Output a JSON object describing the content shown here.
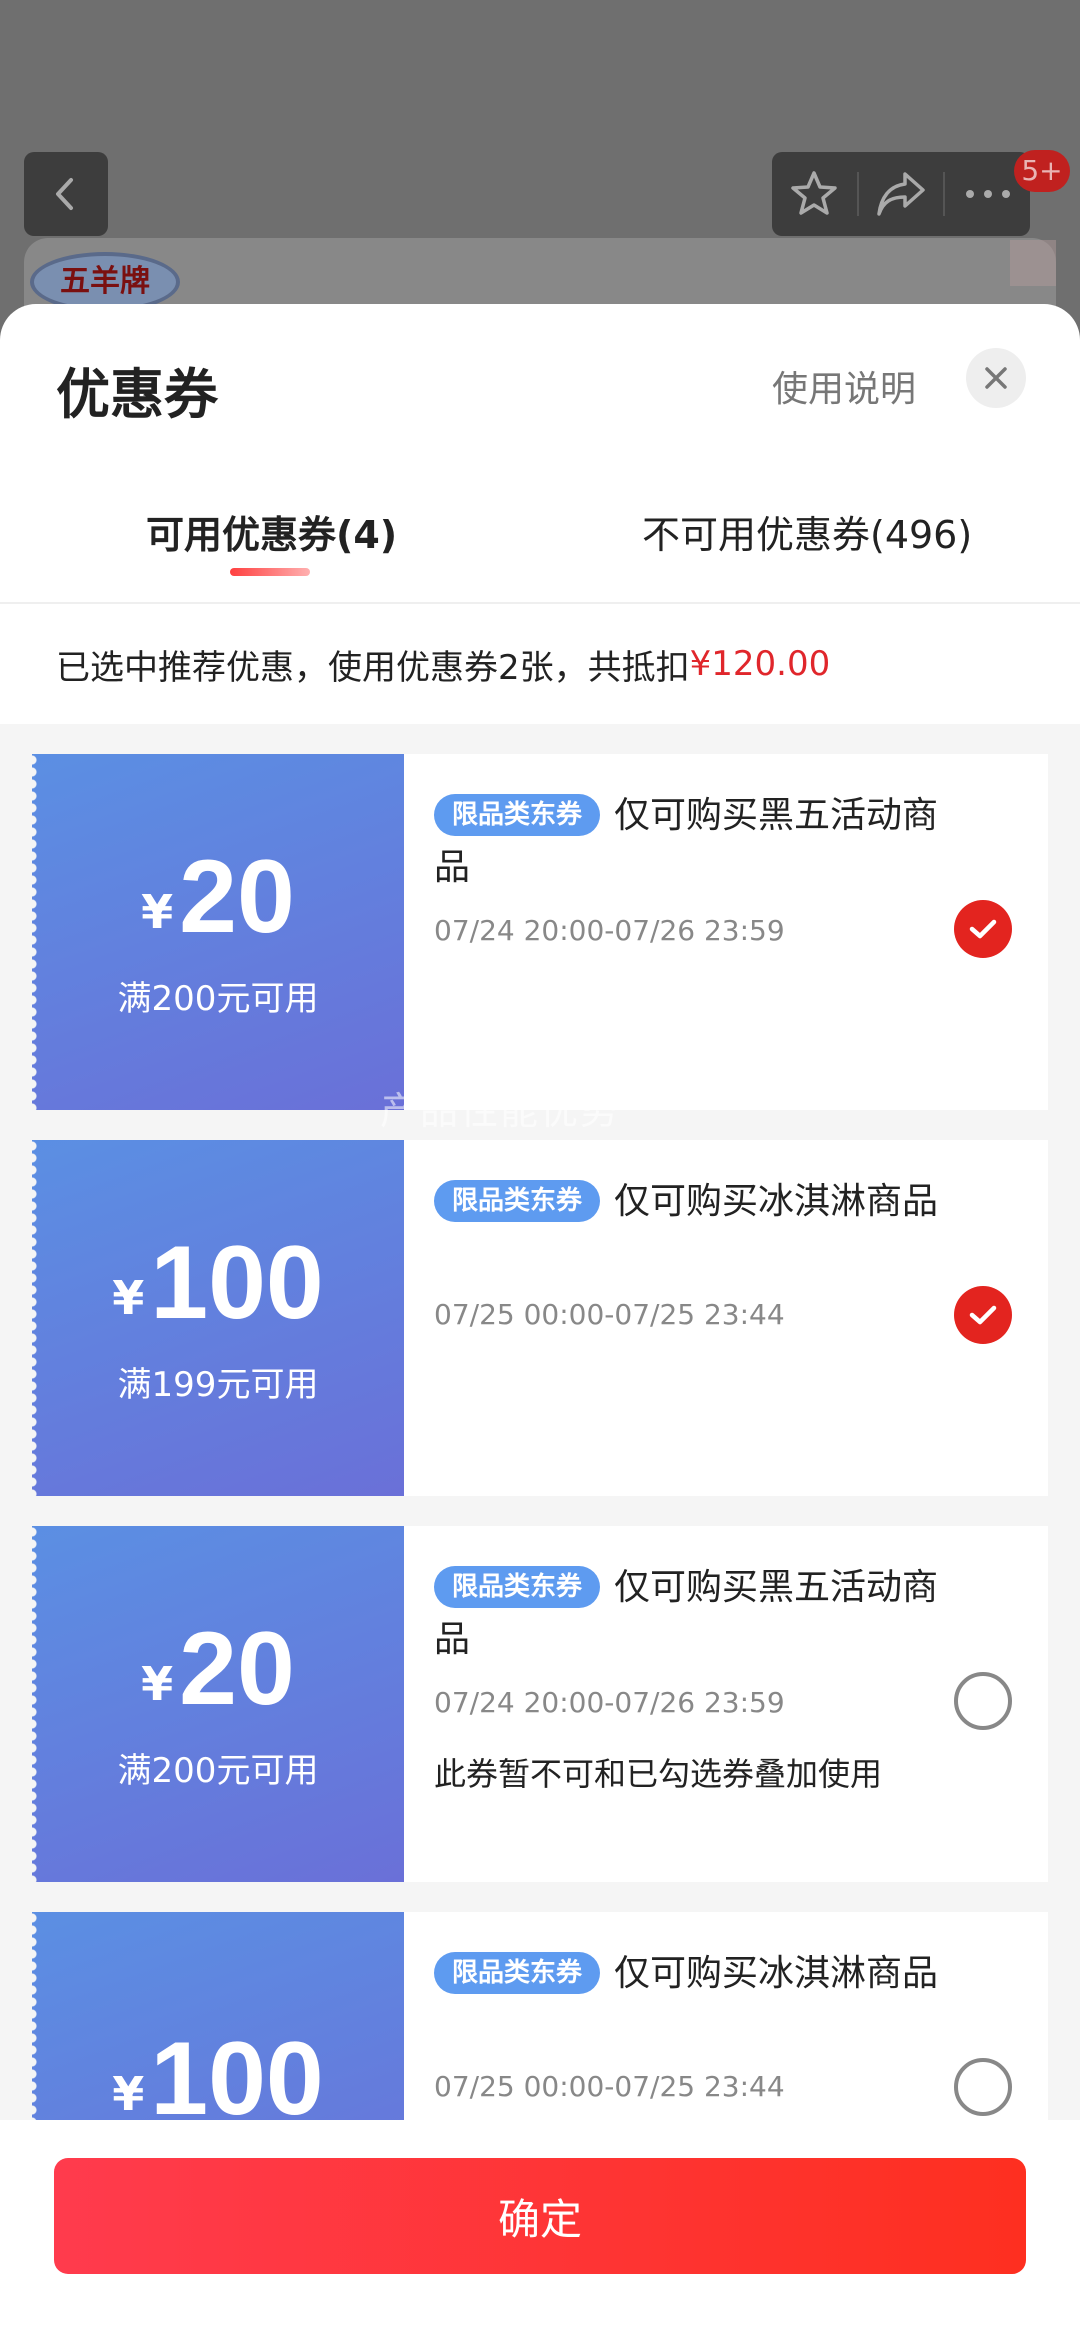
{
  "background": {
    "brand_logo_text": "五羊牌",
    "cart_badge": "5+",
    "icons": {
      "back": "chevron-left-icon",
      "favorite": "star-icon",
      "share": "share-icon",
      "more": "more-dots-icon"
    }
  },
  "sheet": {
    "title": "优惠券",
    "help_link": "使用说明",
    "close_icon": "close-icon"
  },
  "tabs": [
    {
      "label": "可用优惠券(4)",
      "active": true
    },
    {
      "label": "不可用优惠券(496)",
      "active": false
    }
  ],
  "summary": {
    "text": "已选中推荐优惠，使用优惠券2张，共抵扣",
    "amount": "¥120.00"
  },
  "coupons": [
    {
      "currency": "¥",
      "value": "20",
      "threshold": "满200元可用",
      "tag": "限品类东券",
      "title": "仅可购买黑五活动商品",
      "validity": "07/24 20:00-07/26 23:59",
      "note": "",
      "selected": true
    },
    {
      "currency": "¥",
      "value": "100",
      "threshold": "满199元可用",
      "tag": "限品类东券",
      "title": "仅可购买冰淇淋商品",
      "validity": "07/25 00:00-07/25 23:44",
      "note": "",
      "selected": true
    },
    {
      "currency": "¥",
      "value": "20",
      "threshold": "满200元可用",
      "tag": "限品类东券",
      "title": "仅可购买黑五活动商品",
      "validity": "07/24 20:00-07/26 23:59",
      "note": "此券暂不可和已勾选券叠加使用",
      "selected": false
    },
    {
      "currency": "¥",
      "value": "100",
      "threshold": "",
      "tag": "限品类东券",
      "title": "仅可购买冰淇淋商品",
      "validity": "07/25 00:00-07/25 23:44",
      "note": "",
      "selected": false
    }
  ],
  "watermark": "产品性能优势",
  "footer": {
    "confirm_label": "确定"
  },
  "colors": {
    "accent_red": "#e3241f",
    "coupon_blue": "#5b8fe3",
    "tag_blue": "#5e9bf0"
  }
}
